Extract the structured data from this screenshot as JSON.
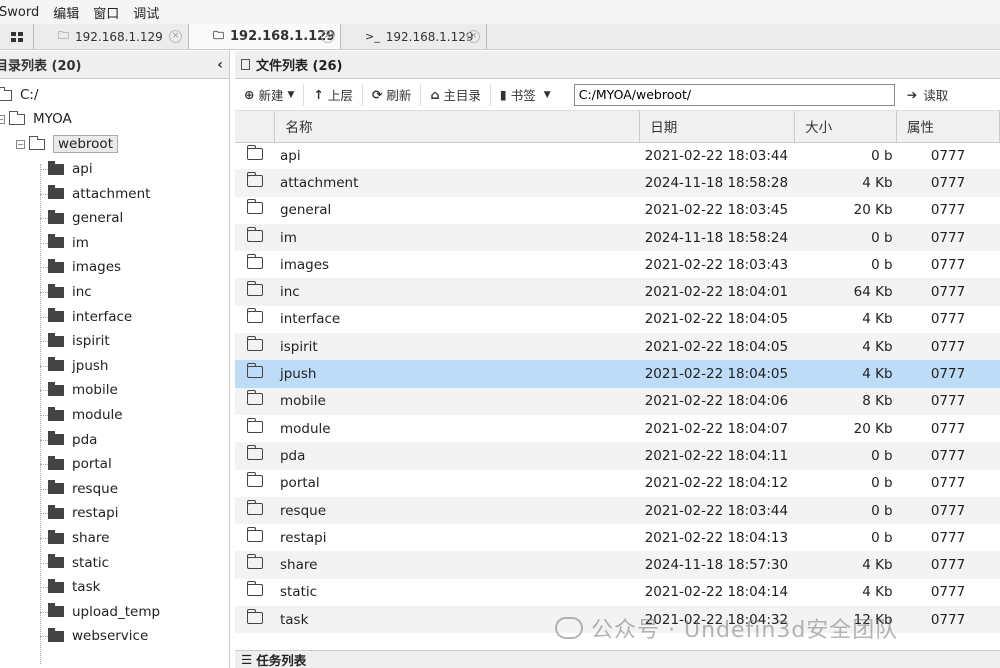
{
  "menu": [
    "Sword",
    "编辑",
    "窗口",
    "调试"
  ],
  "tabs": [
    {
      "icon": "folder-icon",
      "label": "192.168.1.129"
    },
    {
      "icon": "folder-icon",
      "label": "192.168.1.129"
    },
    {
      "icon": "terminal-icon",
      "label": "192.168.1.129"
    }
  ],
  "left_panel": {
    "title": "目录列表 (20)",
    "tree": {
      "root": "C:/",
      "myoa": "MYOA",
      "webroot": "webroot",
      "children": [
        "api",
        "attachment",
        "general",
        "im",
        "images",
        "inc",
        "interface",
        "ispirit",
        "jpush",
        "mobile",
        "module",
        "pda",
        "portal",
        "resque",
        "restapi",
        "share",
        "static",
        "task",
        "upload_temp",
        "webservice"
      ]
    }
  },
  "right_panel": {
    "title": "文件列表 (26)",
    "toolbar": {
      "new_label": "新建",
      "up_label": "上层",
      "refresh_label": "刷新",
      "home_label": "主目录",
      "bookmark_label": "书签",
      "path_value": "C:/MYOA/webroot/",
      "read_label": "读取"
    },
    "columns": [
      "名称",
      "日期",
      "大小",
      "属性"
    ],
    "rows": [
      {
        "name": "api",
        "date": "2021-02-22 18:03:44",
        "size": "0 b",
        "attr": "0777"
      },
      {
        "name": "attachment",
        "date": "2024-11-18 18:58:28",
        "size": "4 Kb",
        "attr": "0777"
      },
      {
        "name": "general",
        "date": "2021-02-22 18:03:45",
        "size": "20 Kb",
        "attr": "0777"
      },
      {
        "name": "im",
        "date": "2024-11-18 18:58:24",
        "size": "0 b",
        "attr": "0777"
      },
      {
        "name": "images",
        "date": "2021-02-22 18:03:43",
        "size": "0 b",
        "attr": "0777"
      },
      {
        "name": "inc",
        "date": "2021-02-22 18:04:01",
        "size": "64 Kb",
        "attr": "0777"
      },
      {
        "name": "interface",
        "date": "2021-02-22 18:04:05",
        "size": "4 Kb",
        "attr": "0777"
      },
      {
        "name": "ispirit",
        "date": "2021-02-22 18:04:05",
        "size": "4 Kb",
        "attr": "0777"
      },
      {
        "name": "jpush",
        "date": "2021-02-22 18:04:05",
        "size": "4 Kb",
        "attr": "0777"
      },
      {
        "name": "mobile",
        "date": "2021-02-22 18:04:06",
        "size": "8 Kb",
        "attr": "0777"
      },
      {
        "name": "module",
        "date": "2021-02-22 18:04:07",
        "size": "20 Kb",
        "attr": "0777"
      },
      {
        "name": "pda",
        "date": "2021-02-22 18:04:11",
        "size": "0 b",
        "attr": "0777"
      },
      {
        "name": "portal",
        "date": "2021-02-22 18:04:12",
        "size": "0 b",
        "attr": "0777"
      },
      {
        "name": "resque",
        "date": "2021-02-22 18:03:44",
        "size": "0 b",
        "attr": "0777"
      },
      {
        "name": "restapi",
        "date": "2021-02-22 18:04:13",
        "size": "0 b",
        "attr": "0777"
      },
      {
        "name": "share",
        "date": "2024-11-18 18:57:30",
        "size": "4 Kb",
        "attr": "0777"
      },
      {
        "name": "static",
        "date": "2021-02-22 18:04:14",
        "size": "4 Kb",
        "attr": "0777"
      },
      {
        "name": "task",
        "date": "2021-02-22 18:04:32",
        "size": "12 Kb",
        "attr": "0777"
      }
    ],
    "selected_row": "jpush"
  },
  "tasks_title": "任务列表",
  "watermark": "公众号 · Undefin3d安全团队",
  "colors": {
    "selected_row": "#bcdcf8",
    "panel_header": "#efefef"
  }
}
